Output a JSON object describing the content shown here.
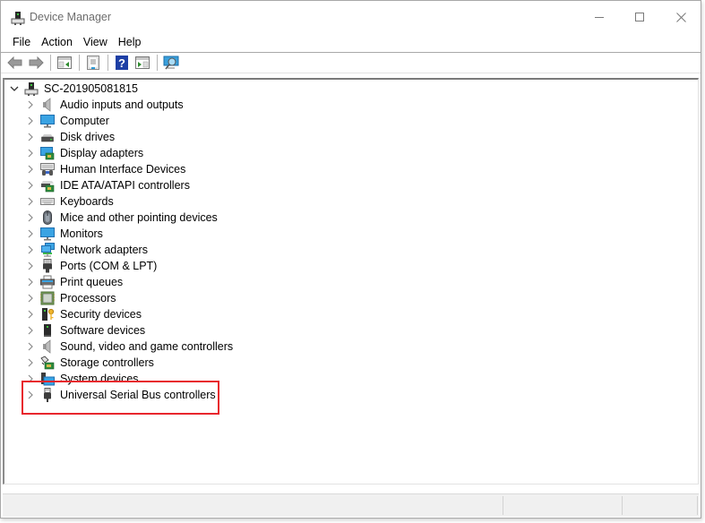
{
  "window": {
    "title": "Device Manager",
    "app_icon": "device-manager-icon",
    "controls": {
      "minimize": "minimize-icon",
      "maximize": "maximize-icon",
      "close": "close-icon"
    }
  },
  "menubar": {
    "items": [
      "File",
      "Action",
      "View",
      "Help"
    ]
  },
  "toolbar": {
    "buttons": [
      {
        "name": "back",
        "icon": "back-arrow-icon"
      },
      {
        "name": "forward",
        "icon": "forward-arrow-icon"
      },
      {
        "name": "show-hide-console-tree",
        "icon": "console-tree-icon"
      },
      {
        "name": "properties",
        "icon": "properties-icon"
      },
      {
        "name": "help",
        "icon": "help-icon"
      },
      {
        "name": "show-action-pane",
        "icon": "action-pane-icon"
      },
      {
        "name": "scan-hardware",
        "icon": "scan-hardware-icon"
      }
    ]
  },
  "tree": {
    "root": {
      "label": "SC-201905081815",
      "expanded": true,
      "icon": "computer-tower-icon"
    },
    "categories": [
      {
        "label": "Audio inputs and outputs",
        "icon": "speaker-icon"
      },
      {
        "label": "Computer",
        "icon": "computer-monitor-icon"
      },
      {
        "label": "Disk drives",
        "icon": "disk-drive-icon"
      },
      {
        "label": "Display adapters",
        "icon": "display-adapter-icon"
      },
      {
        "label": "Human Interface Devices",
        "icon": "hid-icon"
      },
      {
        "label": "IDE ATA/ATAPI controllers",
        "icon": "ide-controller-icon"
      },
      {
        "label": "Keyboards",
        "icon": "keyboard-icon"
      },
      {
        "label": "Mice and other pointing devices",
        "icon": "mouse-icon"
      },
      {
        "label": "Monitors",
        "icon": "monitor-icon"
      },
      {
        "label": "Network adapters",
        "icon": "network-adapter-icon"
      },
      {
        "label": "Ports (COM & LPT)",
        "icon": "port-icon"
      },
      {
        "label": "Print queues",
        "icon": "printer-icon"
      },
      {
        "label": "Processors",
        "icon": "processor-icon"
      },
      {
        "label": "Security devices",
        "icon": "security-device-icon"
      },
      {
        "label": "Software devices",
        "icon": "software-device-icon"
      },
      {
        "label": "Sound, video and game controllers",
        "icon": "sound-icon"
      },
      {
        "label": "Storage controllers",
        "icon": "storage-controller-icon"
      },
      {
        "label": "System devices",
        "icon": "system-devices-icon"
      },
      {
        "label": "Universal Serial Bus controllers",
        "icon": "usb-icon",
        "highlighted": true
      }
    ]
  },
  "annotation": {
    "highlight_color": "#e8262d",
    "target": "Universal Serial Bus controllers"
  },
  "statusbar": {
    "panes": [
      "",
      "",
      ""
    ]
  }
}
